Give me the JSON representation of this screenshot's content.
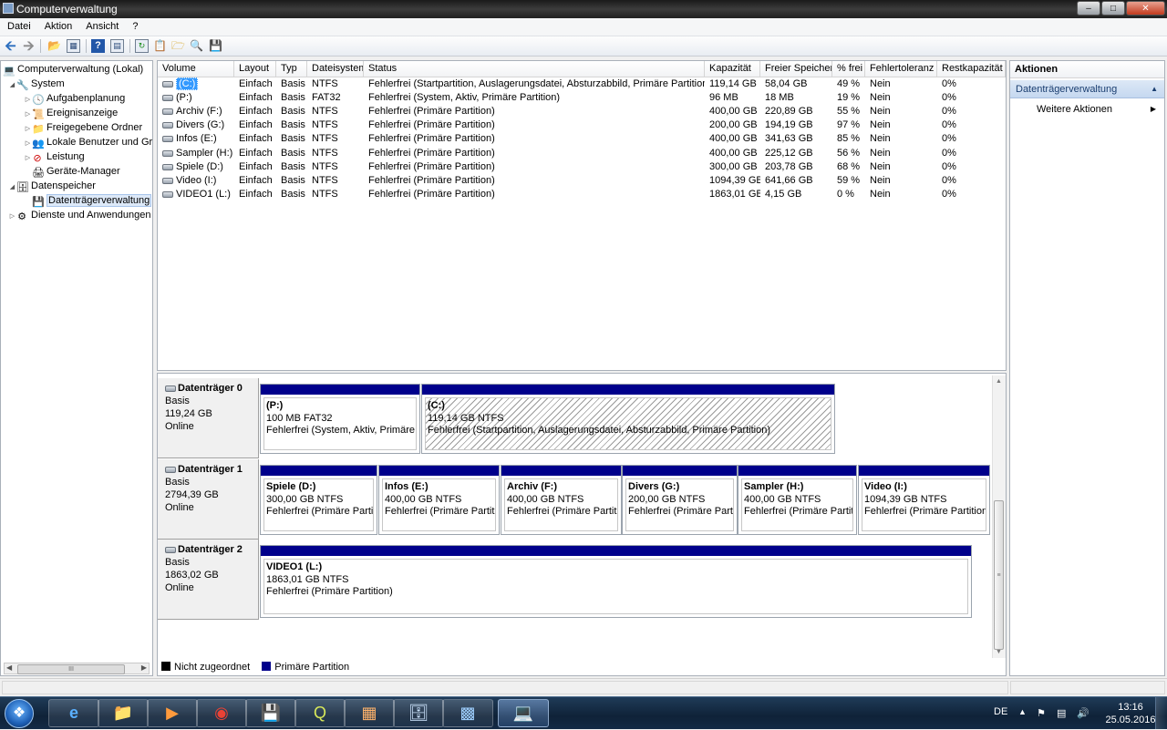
{
  "window": {
    "title": "Computerverwaltung",
    "minimize": "–",
    "restore": "□",
    "close": "✕"
  },
  "menu": [
    "Datei",
    "Aktion",
    "Ansicht",
    "?"
  ],
  "toolbar": {
    "icons": [
      "back-arrow-icon",
      "forward-arrow-icon",
      "up-folder-icon",
      "show-tree-icon",
      "help-icon",
      "console-icon",
      "refresh-icon",
      "properties-icon",
      "open-icon",
      "rescan-icon",
      "export-icon"
    ]
  },
  "tree": {
    "root": "Computerverwaltung (Lokal)",
    "system": "System",
    "aufgaben": "Aufgabenplanung",
    "ereignis": "Ereignisanzeige",
    "freigabe": "Freigegebene Ordner",
    "benutzer": "Lokale Benutzer und Gruppen",
    "leistung": "Leistung",
    "geraete": "Geräte-Manager",
    "datenspeicher": "Datenspeicher",
    "datentraeger": "Datenträgerverwaltung",
    "dienste": "Dienste und Anwendungen",
    "scroll_mid": "III"
  },
  "volumes": {
    "headers": [
      "Volume",
      "Layout",
      "Typ",
      "Dateisystem",
      "Status",
      "Kapazität",
      "Freier Speicher",
      "% frei",
      "Fehlertoleranz",
      "Restkapazität"
    ],
    "rows": [
      [
        "(C:)",
        "Einfach",
        "Basis",
        "NTFS",
        "Fehlerfrei (Startpartition, Auslagerungsdatei, Absturzabbild, Primäre Partition)",
        "119,14 GB",
        "58,04 GB",
        "49 %",
        "Nein",
        "0%"
      ],
      [
        "(P:)",
        "Einfach",
        "Basis",
        "FAT32",
        "Fehlerfrei (System, Aktiv, Primäre Partition)",
        "96 MB",
        "18 MB",
        "19 %",
        "Nein",
        "0%"
      ],
      [
        "Archiv (F:)",
        "Einfach",
        "Basis",
        "NTFS",
        "Fehlerfrei (Primäre Partition)",
        "400,00 GB",
        "220,89 GB",
        "55 %",
        "Nein",
        "0%"
      ],
      [
        "Divers (G:)",
        "Einfach",
        "Basis",
        "NTFS",
        "Fehlerfrei (Primäre Partition)",
        "200,00 GB",
        "194,19 GB",
        "97 %",
        "Nein",
        "0%"
      ],
      [
        "Infos (E:)",
        "Einfach",
        "Basis",
        "NTFS",
        "Fehlerfrei (Primäre Partition)",
        "400,00 GB",
        "341,63 GB",
        "85 %",
        "Nein",
        "0%"
      ],
      [
        "Sampler (H:)",
        "Einfach",
        "Basis",
        "NTFS",
        "Fehlerfrei (Primäre Partition)",
        "400,00 GB",
        "225,12 GB",
        "56 %",
        "Nein",
        "0%"
      ],
      [
        "Spiele (D:)",
        "Einfach",
        "Basis",
        "NTFS",
        "Fehlerfrei (Primäre Partition)",
        "300,00 GB",
        "203,78 GB",
        "68 %",
        "Nein",
        "0%"
      ],
      [
        "Video (I:)",
        "Einfach",
        "Basis",
        "NTFS",
        "Fehlerfrei (Primäre Partition)",
        "1094,39 GB",
        "641,66 GB",
        "59 %",
        "Nein",
        "0%"
      ],
      [
        "VIDEO1 (L:)",
        "Einfach",
        "Basis",
        "NTFS",
        "Fehlerfrei (Primäre Partition)",
        "1863,01 GB",
        "4,15 GB",
        "0 %",
        "Nein",
        "0%"
      ]
    ]
  },
  "disks": [
    {
      "name": "Datenträger 0",
      "type": "Basis",
      "size": "119,24 GB",
      "state": "Online",
      "partitions": [
        {
          "name": "(P:)",
          "size": "100 MB FAT32",
          "status": "Fehlerfrei (System, Aktiv, Primäre P"
        },
        {
          "name": "(C:)",
          "size": "119,14 GB NTFS",
          "status": "Fehlerfrei (Startpartition, Auslagerungsdatei, Absturzabbild, Primäre Partition)"
        }
      ]
    },
    {
      "name": "Datenträger 1",
      "type": "Basis",
      "size": "2794,39 GB",
      "state": "Online",
      "partitions": [
        {
          "name": "Spiele  (D:)",
          "size": "300,00 GB NTFS",
          "status": "Fehlerfrei (Primäre Partition"
        },
        {
          "name": "Infos  (E:)",
          "size": "400,00 GB NTFS",
          "status": "Fehlerfrei (Primäre Partitic"
        },
        {
          "name": "Archiv  (F:)",
          "size": "400,00 GB NTFS",
          "status": "Fehlerfrei (Primäre Partitic"
        },
        {
          "name": "Divers  (G:)",
          "size": "200,00 GB NTFS",
          "status": "Fehlerfrei (Primäre Partit"
        },
        {
          "name": "Sampler  (H:)",
          "size": "400,00 GB NTFS",
          "status": "Fehlerfrei (Primäre Partiti"
        },
        {
          "name": "Video  (I:)",
          "size": "1094,39 GB NTFS",
          "status": "Fehlerfrei (Primäre Partition)"
        }
      ]
    },
    {
      "name": "Datenträger 2",
      "type": "Basis",
      "size": "1863,02 GB",
      "state": "Online",
      "partitions": [
        {
          "name": "VIDEO1  (L:)",
          "size": "1863,01 GB NTFS",
          "status": "Fehlerfrei (Primäre Partition)"
        }
      ]
    }
  ],
  "legend": {
    "unallocated": "Nicht zugeordnet",
    "unallocated_color": "#000000",
    "primary": "Primäre Partition",
    "primary_color": "#00008b"
  },
  "actions": {
    "header": "Aktionen",
    "section": "Datenträgerverwaltung",
    "more": "Weitere Aktionen"
  },
  "taskbar": {
    "apps": [
      "internet-explorer-icon",
      "explorer-folder-icon",
      "media-player-icon",
      "chrome-icon",
      "save-disk-icon",
      "quicktime-icon",
      "window-app-icon",
      "storage-app-icon",
      "control-panel-icon",
      "computer-management-icon"
    ],
    "lang": "DE",
    "time": "13:16",
    "date": "25.05.2016"
  }
}
